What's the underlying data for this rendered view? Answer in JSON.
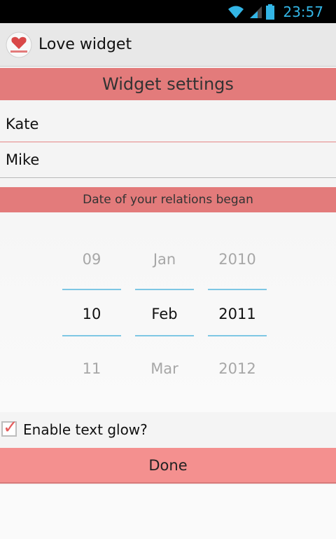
{
  "status_bar": {
    "time": "23:57"
  },
  "action_bar": {
    "title": "Love widget"
  },
  "settings": {
    "header": "Widget settings",
    "name1": "Kate",
    "name2": "Mike",
    "date_header": "Date of your relations began"
  },
  "date_picker": {
    "day": {
      "prev": "09",
      "selected": "10",
      "next": "11"
    },
    "month": {
      "prev": "Jan",
      "selected": "Feb",
      "next": "Mar"
    },
    "year": {
      "prev": "2010",
      "selected": "2011",
      "next": "2012"
    }
  },
  "options": {
    "glow_label": "Enable text glow?",
    "glow_checked": true
  },
  "actions": {
    "done_label": "Done"
  },
  "colors": {
    "accent": "#e37b7b",
    "button": "#f4908f",
    "picker_line": "#7ec7e4",
    "status_text": "#33b5e5"
  }
}
